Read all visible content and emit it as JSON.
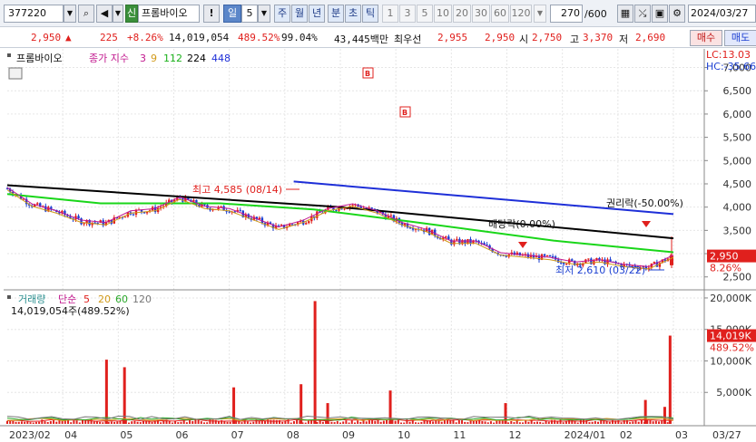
{
  "toolbar": {
    "code": "377220",
    "badge": "신",
    "name": "프롬바이오",
    "excl": "!",
    "period_active": "일",
    "period_num": "5",
    "periods": [
      "주",
      "월",
      "년",
      "분",
      "초",
      "틱"
    ],
    "intervals": [
      "1",
      "3",
      "5",
      "10",
      "20",
      "30",
      "60",
      "120"
    ],
    "count": "270",
    "count_total": "/600",
    "date": "2024/03/27"
  },
  "quote": {
    "price": "2,950",
    "change": "225",
    "change_pct": "+8.26%",
    "volume": "14,019,054",
    "volume_ratio": "489.52%",
    "strength": "99.04%",
    "amount": "43,445백만",
    "best_ask_label": "최우선",
    "best_ask": "2,955",
    "best_bid": "2,950",
    "open_label": "시",
    "open": "2,750",
    "high_label": "고",
    "high": "3,370",
    "low_label": "저",
    "low": "2,690",
    "buy_button": "매수",
    "sell_button": "매도"
  },
  "colors": {
    "up": "#e0201d",
    "down": "#1b3fd1",
    "ma5": "#e0201d",
    "ma20": "#d19a1a",
    "ma60": "#2aa82a",
    "ma120": "#777777",
    "ma3": "#c2188e",
    "ma9": "#d19a1a",
    "ma112": "#19d619",
    "ma224": "#000000",
    "ma448": "#1e2fd8"
  },
  "chart_data": [
    {
      "type": "candlestick",
      "title": "프롬바이오",
      "legend_label": "종가 지수",
      "legend": [
        "3",
        "9",
        "112",
        "224",
        "448"
      ],
      "lc_label": "LC:13.03",
      "hc_label": "HC:-35.66",
      "ylim": [
        2300,
        7400
      ],
      "y_ticks": [
        "7,000",
        "6,500",
        "6,000",
        "5,500",
        "5,000",
        "4,500",
        "4,000",
        "3,500",
        "3,000",
        "2,500"
      ],
      "y_tick_values": [
        7000,
        6500,
        6000,
        5500,
        5000,
        4500,
        4000,
        3500,
        3000,
        2500
      ],
      "x_labels": [
        "2023/02",
        "04",
        "05",
        "06",
        "07",
        "08",
        "09",
        "10",
        "11",
        "12",
        "2024/01",
        "02",
        "03",
        "03/27"
      ],
      "annotations": {
        "high": "최고 4,585 (08/14)",
        "low": "최저 2,610 (03/22)",
        "dividend": "배당락(0.00%)",
        "rights": "권리락(-50.00%)",
        "b_marker": "B"
      },
      "current_price_label": "2,950",
      "current_change_label": "8.26%",
      "close_series": [
        {
          "date": "2023/02",
          "value": 4400
        },
        {
          "date": "03a",
          "value": 4050
        },
        {
          "date": "03b",
          "value": 3900
        },
        {
          "date": "04a",
          "value": 3700
        },
        {
          "date": "04b",
          "value": 3650
        },
        {
          "date": "05a",
          "value": 3900
        },
        {
          "date": "05b",
          "value": 3950
        },
        {
          "date": "06a",
          "value": 4200
        },
        {
          "date": "06b",
          "value": 4000
        },
        {
          "date": "07a",
          "value": 3950
        },
        {
          "date": "07b",
          "value": 3750
        },
        {
          "date": "08a",
          "value": 3550
        },
        {
          "date": "08b",
          "value": 3700
        },
        {
          "date": "08c",
          "value": 3950
        },
        {
          "date": "09a",
          "value": 4050
        },
        {
          "date": "09b",
          "value": 3900
        },
        {
          "date": "10a",
          "value": 3650
        },
        {
          "date": "10b",
          "value": 3500
        },
        {
          "date": "11a",
          "value": 3250
        },
        {
          "date": "11b",
          "value": 3250
        },
        {
          "date": "12a",
          "value": 3000
        },
        {
          "date": "12b",
          "value": 2950
        },
        {
          "date": "2024/01a",
          "value": 2900
        },
        {
          "date": "01b",
          "value": 2800
        },
        {
          "date": "02a",
          "value": 2850
        },
        {
          "date": "02b",
          "value": 2750
        },
        {
          "date": "03a",
          "value": 2700
        },
        {
          "date": "03/27",
          "value": 2950
        }
      ],
      "ma_lines": [
        {
          "name": "112",
          "points": [
            [
              0,
              4280
            ],
            [
              0.14,
              4080
            ],
            [
              0.32,
              4080
            ],
            [
              0.46,
              3950
            ],
            [
              0.6,
              3700
            ],
            [
              0.82,
              3280
            ],
            [
              1,
              3030
            ]
          ]
        },
        {
          "name": "224",
          "points": [
            [
              0,
              4470
            ],
            [
              0.5,
              4000
            ],
            [
              1,
              3330
            ]
          ]
        },
        {
          "name": "448",
          "points": [
            [
              0.43,
              4550
            ],
            [
              1,
              3850
            ]
          ]
        }
      ]
    },
    {
      "type": "bar",
      "title": "거래량",
      "legend_label": "단순",
      "legend": [
        "5",
        "20",
        "60",
        "120"
      ],
      "volume_label": "14,019,054주(489.52%)",
      "ylim": [
        0,
        21000
      ],
      "y_ticks": [
        "20,000K",
        "15,000K",
        "10,000K",
        "5,000K"
      ],
      "y_tick_values": [
        20000,
        15000,
        10000,
        5000
      ],
      "current_volume_label": "14,019K",
      "current_ratio_label": "489.52%",
      "spikes": [
        {
          "pos": 0.149,
          "value": 10200
        },
        {
          "pos": 0.176,
          "value": 9000
        },
        {
          "pos": 0.34,
          "value": 5800
        },
        {
          "pos": 0.441,
          "value": 6300
        },
        {
          "pos": 0.462,
          "value": 19500
        },
        {
          "pos": 0.481,
          "value": 3300
        },
        {
          "pos": 0.575,
          "value": 5300
        },
        {
          "pos": 0.748,
          "value": 3300
        },
        {
          "pos": 0.958,
          "value": 3800
        },
        {
          "pos": 0.987,
          "value": 2700
        },
        {
          "pos": 0.995,
          "value": 14019
        }
      ]
    }
  ]
}
